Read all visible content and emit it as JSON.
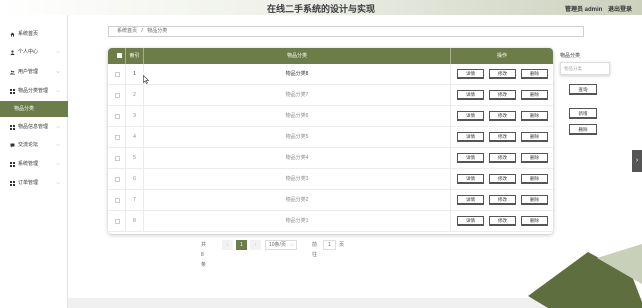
{
  "header": {
    "title": "在线二手系统的设计与实现",
    "user_label": "管理员 admin",
    "logout_label": "退出登录"
  },
  "sidebar": {
    "items": [
      {
        "label": "系统首页",
        "icon": "home-icon",
        "chevron": false
      },
      {
        "label": "个人中心",
        "icon": "person-icon",
        "chevron": true
      },
      {
        "label": "用户管理",
        "icon": "users-icon",
        "chevron": true
      },
      {
        "label": "物品分类管理",
        "icon": "grid-icon",
        "chevron": true
      },
      {
        "label": "物品分类",
        "icon": "",
        "chevron": false,
        "active": true
      },
      {
        "label": "物品信息管理",
        "icon": "grid-icon",
        "chevron": true
      },
      {
        "label": "交流论坛",
        "icon": "chat-icon",
        "chevron": true
      },
      {
        "label": "系统管理",
        "icon": "grid-icon",
        "chevron": true
      },
      {
        "label": "订单管理",
        "icon": "grid-icon",
        "chevron": true
      }
    ]
  },
  "breadcrumb": {
    "home": "系统首页",
    "separator": "/",
    "current": "物品分类"
  },
  "table": {
    "headers": {
      "index": "索引",
      "name": "物品分类",
      "ops": "操作"
    },
    "rows": [
      {
        "index": "1",
        "name": "物品分类8"
      },
      {
        "index": "2",
        "name": "物品分类7"
      },
      {
        "index": "3",
        "name": "物品分类6"
      },
      {
        "index": "4",
        "name": "物品分类5"
      },
      {
        "index": "5",
        "name": "物品分类4"
      },
      {
        "index": "6",
        "name": "物品分类3"
      },
      {
        "index": "7",
        "name": "物品分类2"
      },
      {
        "index": "8",
        "name": "物品分类1"
      }
    ],
    "buttons": {
      "detail": "详情",
      "edit": "修改",
      "delete": "删除"
    }
  },
  "search_panel": {
    "label": "物品分类",
    "placeholder": "物品分类",
    "search_button": "查询",
    "add_button": "新增",
    "delete_button": "删除"
  },
  "pagination": {
    "total_text": "共 8 条",
    "prev": "‹",
    "current_page": "1",
    "next": "›",
    "page_size": "10条/页",
    "goto_label": "前往",
    "goto_value": "1",
    "page_unit": "页"
  },
  "colors": {
    "accent": "#6b7d48",
    "dark_deco": "#5f6e3e"
  }
}
